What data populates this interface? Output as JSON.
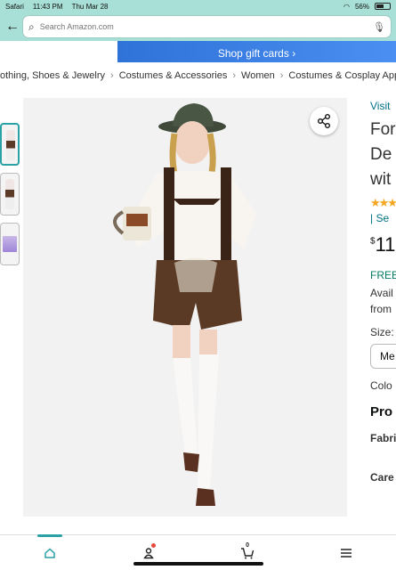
{
  "status_bar": {
    "app": "Safari",
    "time": "11:43 PM",
    "date": "Thu Mar 28",
    "battery": "56%",
    "battery_level": 0.56
  },
  "search": {
    "placeholder": "Search Amazon.com"
  },
  "banner": {
    "text": "Shop gift cards ›"
  },
  "breadcrumb": [
    "othing, Shoes & Jewelry",
    "Costumes & Accessories",
    "Women",
    "Costumes & Cosplay App"
  ],
  "product": {
    "visit_text": "Visit",
    "title_lines": [
      "For",
      "De",
      "wit"
    ],
    "stars": "★★★",
    "see": "| Se",
    "price_symbol": "$",
    "price": "11",
    "free": "FREE",
    "avail_lines": [
      "Avail",
      "from"
    ],
    "size_label": "Size:",
    "size_value": "Me",
    "color_label": "Colo",
    "prod_heading": "Pro",
    "fabric_label": "Fabri",
    "care_label": "Care"
  },
  "colors": {
    "status_teal": "#a8dfd6",
    "accent": "#2aa2a6",
    "banner_blue": "#2f72d8",
    "link": "#007185",
    "star": "#f4a623",
    "free_green": "#067d62"
  },
  "bottom_nav": {
    "cart_count": "0"
  }
}
